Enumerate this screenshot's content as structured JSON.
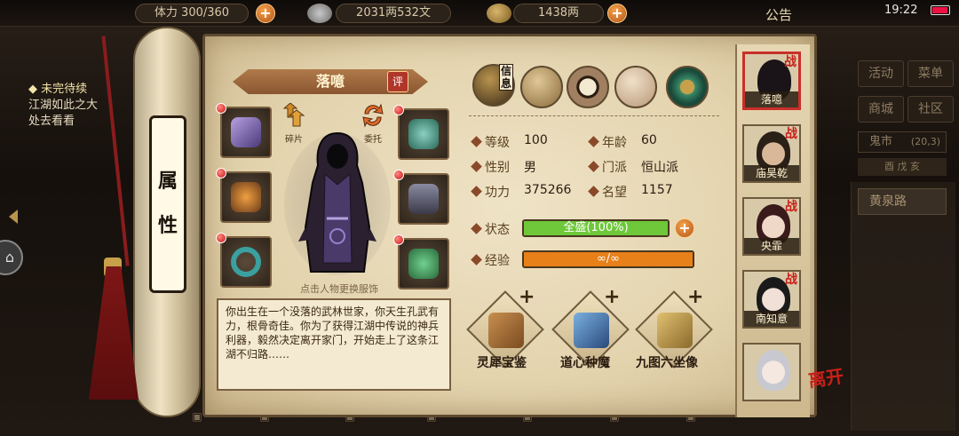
{
  "topbar": {
    "stamina": "体力 300/360",
    "money1": "2031两532文",
    "money2": "1438两",
    "announce": "公告",
    "clock": "19:22"
  },
  "quest": {
    "header": "◆ 未完待续",
    "text": "江湖如此之大\n处去看看"
  },
  "right_menu": {
    "activity": "活动",
    "menu": "菜单",
    "mall": "商城",
    "community": "社区",
    "ghost_market": "鬼市",
    "ghost_market_loc": "(20,3)",
    "ghost_sub": "酉 戊 亥",
    "yellow_spring": "黄泉路"
  },
  "scroll": {
    "title": "属\n性"
  },
  "hero": {
    "name": "落噫",
    "rate_label": "评",
    "shard_label": "碎片",
    "commission_label": "委托",
    "outfit_hint": "点击人物更换服饰",
    "bio": "你出生在一个没落的武林世家，你天生孔武有力，根骨奇佳。你为了获得江湖中传说的神兵利器，毅然决定离开家门，开始走上了这条江湖不归路……"
  },
  "tabs": {
    "info_label": "信息"
  },
  "stats": {
    "level_label": "等级",
    "level": "100",
    "age_label": "年龄",
    "age": "60",
    "gender_label": "性别",
    "gender": "男",
    "sect_label": "门派",
    "sect": "恒山派",
    "power_label": "功力",
    "power": "375266",
    "fame_label": "名望",
    "fame": "1157",
    "state_label": "状态",
    "state_text": "全盛(100%)",
    "state_fraction": 1.0,
    "exp_label": "经验",
    "exp_text": "∞/∞",
    "exp_fraction": 1.0
  },
  "books": [
    {
      "label": "灵犀宝鉴"
    },
    {
      "label": "道心种魔"
    },
    {
      "label": "九图六坐像"
    }
  ],
  "party": [
    {
      "name": "落噫",
      "fight": "战"
    },
    {
      "name": "庙昊乾",
      "fight": "战"
    },
    {
      "name": "央霏",
      "fight": "战"
    },
    {
      "name": "南知意",
      "fight": "战"
    },
    {
      "name": ""
    }
  ],
  "leave_label": "离开",
  "colors": {
    "state_bar": "#6ec83a",
    "exp_bar": "#e8801a",
    "accent_red": "#c8201a"
  }
}
